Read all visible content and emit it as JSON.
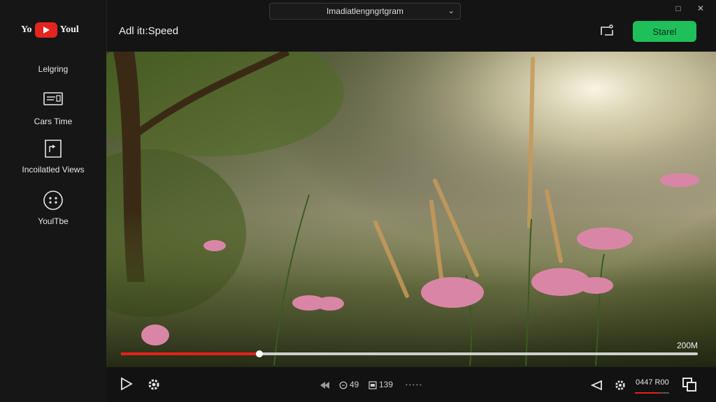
{
  "window": {
    "search_title": "Imadiatlengngrtgram",
    "dropdown_icon": "chevron-down-icon",
    "controls": [
      "restore-icon",
      "close-icon"
    ]
  },
  "logo": {
    "left": "Yo",
    "right": "Youl"
  },
  "sidebar": {
    "items": [
      {
        "label": "Lelgring",
        "icon": ""
      },
      {
        "label": "Cars Time",
        "icon": "screen-icon"
      },
      {
        "label": "Incoilatled Views",
        "icon": "file-icon"
      },
      {
        "label": "YoulTbe",
        "icon": "face-icon"
      }
    ]
  },
  "header": {
    "title": "Adl itı:Speed",
    "start_label": "Starel",
    "cast_icon": "cast-icon"
  },
  "video": {
    "duration_label": "200M",
    "progress": 0.24
  },
  "controls": {
    "time_a": "49",
    "time_b": "139",
    "dots": "• • • • •",
    "time_readout": "0447 R00",
    "volume": 0.72
  },
  "colors": {
    "accent": "#1fbf5a",
    "brand_red": "#e52420",
    "progress_red": "#e8201c"
  }
}
